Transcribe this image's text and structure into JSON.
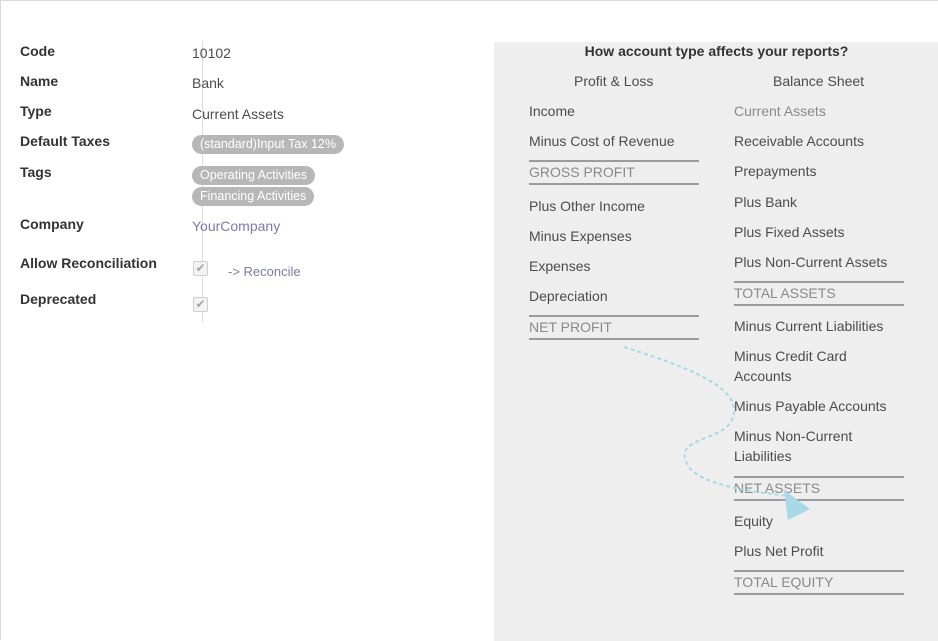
{
  "form": {
    "fields": {
      "code": {
        "label": "Code",
        "value": "10102"
      },
      "name": {
        "label": "Name",
        "value": "Bank"
      },
      "type": {
        "label": "Type",
        "value": "Current Assets"
      },
      "default_taxes": {
        "label": "Default Taxes",
        "tags": [
          "(standard)Input Tax 12%"
        ]
      },
      "tags": {
        "label": "Tags",
        "tags": [
          "Operating Activities",
          "Financing Activities"
        ]
      },
      "company": {
        "label": "Company",
        "value": "YourCompany"
      },
      "allow_reconciliation": {
        "label": "Allow Reconciliation",
        "checked": true,
        "link": "-> Reconcile"
      },
      "deprecated": {
        "label": "Deprecated",
        "checked": true
      }
    }
  },
  "help_panel": {
    "title": "How account type affects your reports?",
    "profit_loss": {
      "heading": "Profit & Loss",
      "items": [
        {
          "text": "Income",
          "muted": false
        },
        {
          "text": "Minus Cost of Revenue",
          "muted": false
        },
        {
          "text": "GROSS PROFIT",
          "total": true
        },
        {
          "text": "Plus Other Income",
          "muted": false
        },
        {
          "text": "Minus Expenses",
          "muted": false
        },
        {
          "text": "Expenses",
          "muted": false
        },
        {
          "text": "Depreciation",
          "muted": false
        },
        {
          "text": "NET PROFIT",
          "total": true
        }
      ]
    },
    "balance_sheet": {
      "heading": "Balance Sheet",
      "items": [
        {
          "text": "Current Assets",
          "muted": true
        },
        {
          "text": "Receivable Accounts",
          "muted": false
        },
        {
          "text": "Prepayments",
          "muted": false
        },
        {
          "text": "Plus Bank",
          "muted": false
        },
        {
          "text": "Plus Fixed Assets",
          "muted": false
        },
        {
          "text": "Plus Non-Current Assets",
          "muted": false
        },
        {
          "text": "TOTAL ASSETS",
          "total": true
        },
        {
          "text": "Minus Current Liabilities",
          "muted": false
        },
        {
          "text": "Minus Credit Card Accounts",
          "muted": false
        },
        {
          "text": "Minus Payable Accounts",
          "muted": false
        },
        {
          "text": "Minus Non-Current Liabilities",
          "muted": false
        },
        {
          "text": "NET ASSETS",
          "total": true
        },
        {
          "text": "Equity",
          "muted": false
        },
        {
          "text": "Plus Net Profit",
          "muted": false
        },
        {
          "text": "TOTAL EQUITY",
          "total": true
        }
      ]
    },
    "arrow_color": "#a9d8e8"
  }
}
